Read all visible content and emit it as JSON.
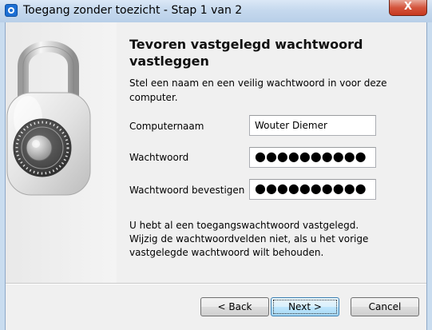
{
  "window": {
    "title": "Toegang zonder toezicht - Stap 1 van 2",
    "close_glyph": "X"
  },
  "wizard": {
    "heading": "Tevoren vastgelegd wachtwoord vastleggen",
    "subtitle": "Stel een naam en een veilig wachtwoord in voor deze computer.",
    "fields": {
      "computer_name": {
        "label": "Computernaam",
        "value": "Wouter Diemer"
      },
      "password": {
        "label": "Wachtwoord",
        "value": "●●●●●●●●●●"
      },
      "confirm": {
        "label": "Wachtwoord bevestigen",
        "value": "●●●●●●●●●●"
      }
    },
    "note": "U hebt al een toegangswachtwoord vastgelegd. Wijzig de wachtwoordvelden niet, als u het vorige vastgelegde wachtwoord wilt behouden."
  },
  "buttons": {
    "back": "< Back",
    "next": "Next >",
    "cancel": "Cancel"
  },
  "icons": {
    "app": "teamviewer-icon",
    "padlock": "padlock-icon"
  },
  "colors": {
    "titlebar": "#c6d9ee",
    "close": "#c7381f",
    "dialog": "#f0f0f0",
    "default_button": "#bee6fd"
  }
}
